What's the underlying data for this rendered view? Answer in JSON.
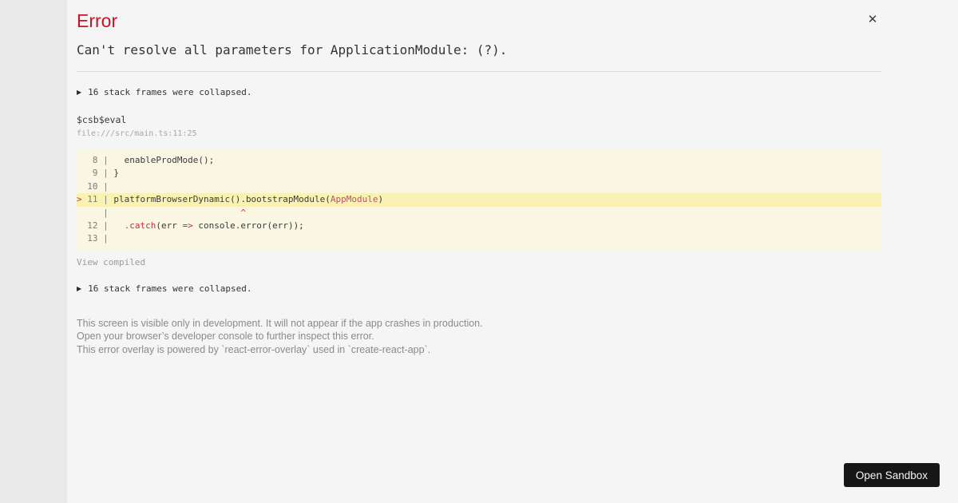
{
  "overlay": {
    "title": "Error",
    "close_glyph": "✕",
    "message": "Can't resolve all parameters for ApplicationModule: (?).",
    "expand_icon": "▶",
    "stack_collapsed_top": "16 stack frames were collapsed.",
    "frame": {
      "function": "$csb$eval",
      "location": "file:///src/main.ts:11:25"
    },
    "view_compiled": "View compiled",
    "stack_collapsed_bottom": "16 stack frames were collapsed.",
    "footer_lines": [
      "This screen is visible only in development. It will not appear if the app crashes in production.",
      "Open your browser’s developer console to further inspect this error.",
      "This error overlay is powered by `react-error-overlay` used in `create-react-app`."
    ]
  },
  "code": {
    "lines": [
      {
        "highlight": false,
        "tokens": [
          {
            "t": "   8 | ",
            "c": "gutter"
          },
          {
            "t": "  enableProdMode();",
            "c": "code"
          }
        ]
      },
      {
        "highlight": false,
        "tokens": [
          {
            "t": "   9 | ",
            "c": "gutter"
          },
          {
            "t": "}",
            "c": "code"
          }
        ]
      },
      {
        "highlight": false,
        "tokens": [
          {
            "t": "  10 | ",
            "c": "gutter"
          }
        ]
      },
      {
        "highlight": true,
        "tokens": [
          {
            "t": "> ",
            "c": "red"
          },
          {
            "t": "11 | ",
            "c": "gutter"
          },
          {
            "t": "platformBrowserDynamic().bootstrapModule(",
            "c": "code"
          },
          {
            "t": "AppModule",
            "c": "rose"
          },
          {
            "t": ")",
            "c": "code"
          }
        ]
      },
      {
        "highlight": false,
        "tokens": [
          {
            "t": "     | ",
            "c": "gutter"
          },
          {
            "t": "                        ",
            "c": "code"
          },
          {
            "t": "^",
            "c": "red"
          }
        ]
      },
      {
        "highlight": false,
        "tokens": [
          {
            "t": "  12 | ",
            "c": "gutter"
          },
          {
            "t": "  ",
            "c": "code"
          },
          {
            "t": ".catch",
            "c": "red"
          },
          {
            "t": "(err ",
            "c": "code"
          },
          {
            "t": "=>",
            "c": "red"
          },
          {
            "t": " console.error(err));",
            "c": "code"
          }
        ]
      },
      {
        "highlight": false,
        "tokens": [
          {
            "t": "  13 | ",
            "c": "gutter"
          }
        ]
      }
    ]
  },
  "sandbox_button": {
    "label": "Open Sandbox"
  },
  "colors": {
    "error_red": "#ce1126",
    "code_block_bg": "#f9f6e2",
    "code_highlight_bg": "#faf2b3",
    "token_red": "#c5303c",
    "token_rose": "#b3566f",
    "panel_bg": "#f5f5f5",
    "page_bg": "#e9e9e9",
    "button_bg": "#161616"
  }
}
